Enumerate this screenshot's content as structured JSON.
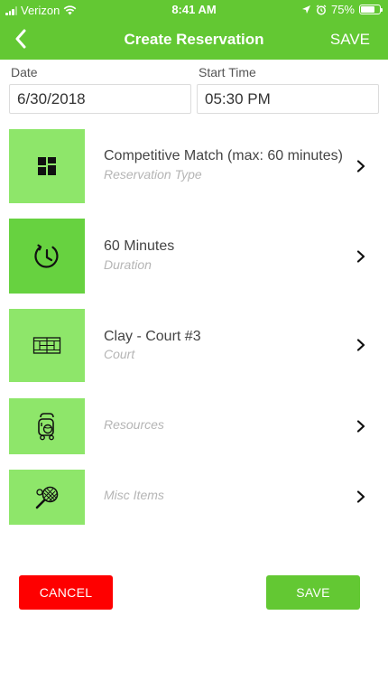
{
  "status_bar": {
    "carrier": "Verizon",
    "time": "8:41 AM",
    "battery": "75%",
    "battery_level": 0.75
  },
  "nav": {
    "title": "Create Reservation",
    "save_label": "SAVE"
  },
  "date_field": {
    "label": "Date",
    "value": "6/30/2018"
  },
  "time_field": {
    "label": "Start Time",
    "value": "05:30 PM"
  },
  "rows": [
    {
      "value": "Competitive Match (max: 60 minutes)",
      "sub": "Reservation Type",
      "icon": "grid-icon"
    },
    {
      "value": "60 Minutes",
      "sub": "Duration",
      "icon": "clock-icon"
    },
    {
      "value": "Clay - Court #3",
      "sub": "Court",
      "icon": "court-icon"
    },
    {
      "value": "",
      "sub": "Resources",
      "icon": "ball-machine-icon"
    },
    {
      "value": "",
      "sub": "Misc Items",
      "icon": "racquet-icon"
    }
  ],
  "buttons": {
    "cancel": "CANCEL",
    "save": "SAVE"
  },
  "colors": {
    "header": "#63c833",
    "tile": "#8ee66a",
    "tile_active": "#67d240",
    "cancel": "#fe0000",
    "save": "#63c833"
  }
}
